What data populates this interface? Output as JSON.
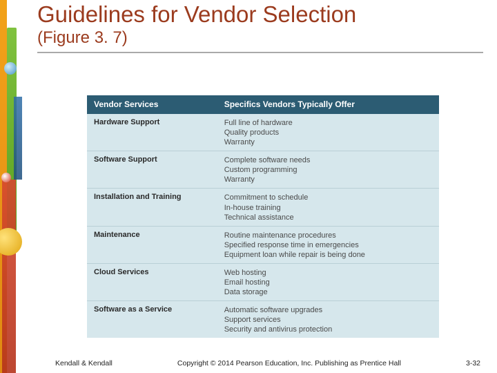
{
  "title": "Guidelines for Vendor Selection",
  "subtitle": "(Figure 3. 7)",
  "table": {
    "header": {
      "col1": "Vendor Services",
      "col2": "Specifics Vendors Typically Offer"
    },
    "rows": [
      {
        "service": "Hardware Support",
        "specs": [
          "Full line of hardware",
          "Quality products",
          "Warranty"
        ]
      },
      {
        "service": "Software Support",
        "specs": [
          "Complete software needs",
          "Custom programming",
          "Warranty"
        ]
      },
      {
        "service": "Installation and Training",
        "specs": [
          "Commitment to schedule",
          "In-house training",
          "Technical assistance"
        ]
      },
      {
        "service": "Maintenance",
        "specs": [
          "Routine maintenance procedures",
          "Specified response time in emergencies",
          "Equipment loan while repair is being done"
        ]
      },
      {
        "service": "Cloud Services",
        "specs": [
          "Web hosting",
          "Email hosting",
          "Data storage"
        ]
      },
      {
        "service": "Software as a Service",
        "specs": [
          "Automatic software upgrades",
          "Support services",
          "Security and antivirus protection"
        ]
      }
    ]
  },
  "footer": {
    "authors": "Kendall & Kendall",
    "copyright": "Copyright © 2014 Pearson Education, Inc. Publishing as Prentice Hall",
    "pageno": "3-32"
  }
}
